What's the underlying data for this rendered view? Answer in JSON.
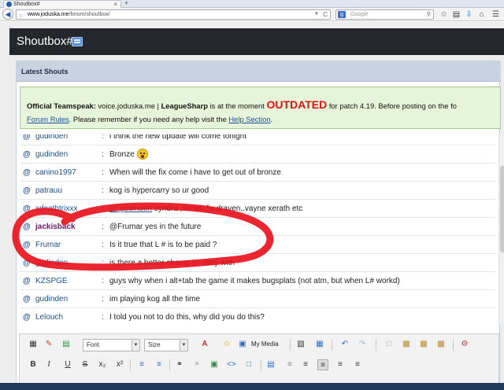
{
  "browser": {
    "tab_title": "Shoutbox#",
    "tab_close": "×",
    "new_tab": "+",
    "url_domain": "www.joduska.me",
    "url_path": "/forum/shoutbox/",
    "search_placeholder": "Google"
  },
  "header": {
    "title": "Shoutbox#"
  },
  "panel": {
    "title": "Latest Shouts"
  },
  "notice": {
    "line1_a": "Official Teamspeak:",
    "line1_b": " voice.joduska.me | ",
    "line1_c": "LeagueSharp",
    "line1_d": " is at the moment ",
    "line1_outdated": "OUTDATED",
    "line1_e": " for patch 4.19. Before posting on the fo",
    "line2_rules": "Forum Rules",
    "line2_mid": ". Please remember if you need any help visit the ",
    "line2_help": "Help Section",
    "line2_end": "."
  },
  "shouts": [
    {
      "at": "@",
      "user": "gudinden",
      "colon": ":",
      "msg": "i think the new update will come tonight"
    },
    {
      "at": "@",
      "user": "gudinden",
      "colon": ":",
      "msg": "Bronze"
    },
    {
      "at": "@",
      "user": "canino1997",
      "colon": ":",
      "msg": "When will the fix come i have to get out of bronze"
    },
    {
      "at": "@",
      "user": "patrauu",
      "colon": ":",
      "msg": "kog is hypercarry so ur good"
    },
    {
      "at": "@",
      "user": "xdeathtrixxx",
      "colon": ":",
      "mention": "@ gudinden",
      "msg": " syndra ,xerath,fix draven,.vayne xerath etc"
    },
    {
      "at": "@",
      "user": "jackisback",
      "colon": ":",
      "msg": "@Frumar yes in the future"
    },
    {
      "at": "@",
      "user": "Frumar",
      "colon": ":",
      "msg": "Is it true that L # is to be paid ?"
    },
    {
      "at": "@",
      "user": "gudinden",
      "colon": ":",
      "msg": "is there a better champ to carry with"
    },
    {
      "at": "@",
      "user": "KZSPGE",
      "colon": ":",
      "msg": "guys why when i alt+tab the game it makes bugsplats (not atm, but when L# workd)"
    },
    {
      "at": "@",
      "user": "gudinden",
      "colon": ":",
      "msg": "im playing kog all the time"
    },
    {
      "at": "@",
      "user": "Lelouch",
      "colon": ":",
      "msg": "I told you not to do this, why did you do this?"
    }
  ],
  "editor": {
    "font_label": "Font",
    "size_label": "Size",
    "my_media_label": "My Media",
    "bold": "B",
    "italic": "I",
    "underline": "U",
    "strike": "S",
    "subscript": "x₂",
    "superscript": "x²"
  },
  "colors": {
    "header_bg": "#24272b",
    "panel_header_bg": "#c7d3e1",
    "notice_bg": "#e6f5d9",
    "outdated": "#e01010",
    "link": "#1c4fa3",
    "highlight_marker": "#e8141e"
  }
}
